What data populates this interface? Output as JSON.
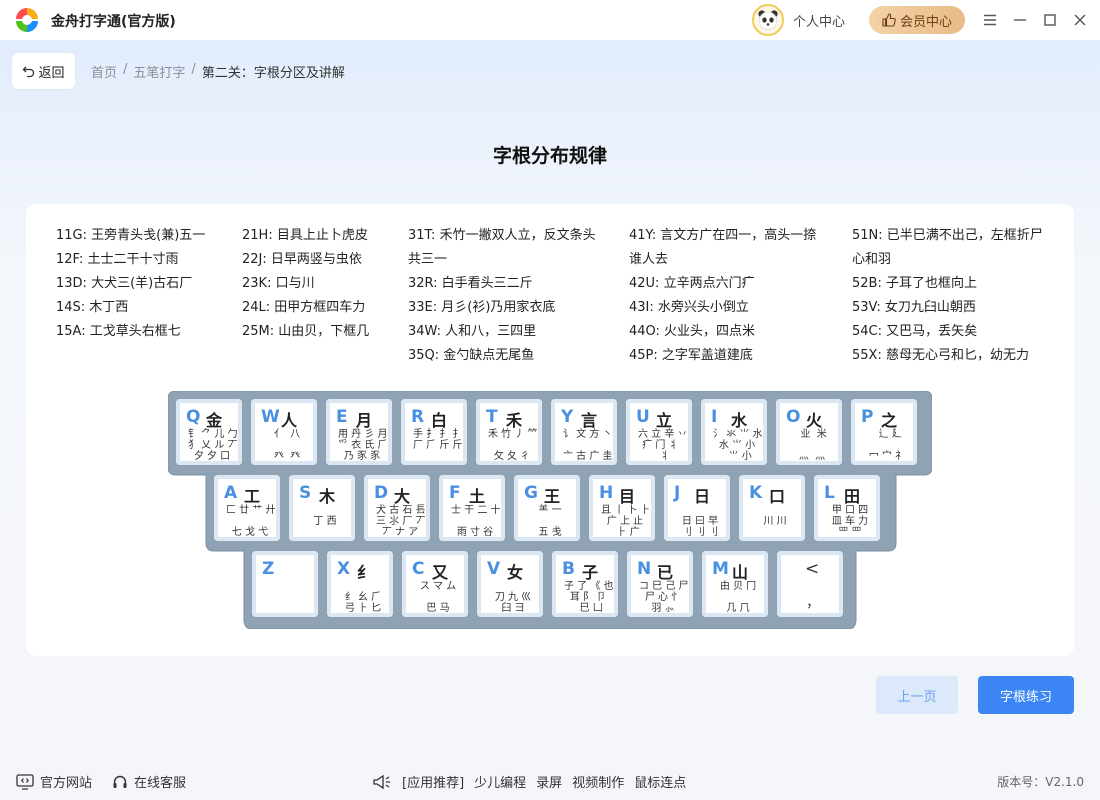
{
  "app": {
    "title": "金舟打字通(官方版)",
    "personal_center": "个人中心",
    "vip_center": "会员中心"
  },
  "nav": {
    "back_label": "返回",
    "breadcrumb": [
      "首页",
      "/",
      "五笔打字",
      "/",
      "第二关：字根分区及讲解"
    ]
  },
  "page": {
    "title": "字根分布规律"
  },
  "zones": {
    "col1": [
      "11G: 王旁青头戋(兼)五一",
      "12F: 土士二干十寸雨",
      "13D: 大犬三(羊)古石厂",
      "14S: 木丁西",
      "15A: 工戈草头右框七"
    ],
    "col2": [
      "21H: 目具上止卜虎皮",
      "22J: 日早两竖与虫依",
      "23K: 口与川",
      "24L: 田甲方框四车力",
      "25M: 山由贝，下框几"
    ],
    "col3": [
      "31T: 禾竹一撇双人立，反文条头共三一",
      "32R: 白手看头三二斤",
      "33E: 月彡(衫)乃用家衣底",
      "34W: 人和八，三四里",
      "35Q: 金勺缺点无尾鱼"
    ],
    "col4": [
      "41Y: 言文方广在四一，高头一捺谁人去",
      "42U: 立辛两点六门疒",
      "43I: 水旁兴头小倒立",
      "44O: 火业头，四点米",
      "45P: 之字军盖道建底"
    ],
    "col5": [
      "51N: 已半巳满不出己，左框折尸心和羽",
      "52B: 子耳了也框向上",
      "53V: 女刀九臼山朝西",
      "54C: 又巴马，丢矢矣",
      "55X: 慈母无心弓和匕，幼无力"
    ]
  },
  "keyboard": {
    "row1": [
      {
        "letter": "Q",
        "char": "金",
        "roots": "钅 ⺈ 儿 勹\n犭 乂 ル 丆\n夕 夕 口"
      },
      {
        "letter": "W",
        "char": "人",
        "roots": "亻  八\n  \n癶  癶"
      },
      {
        "letter": "E",
        "char": "月",
        "roots": "用 丹 彡 月\n爫 衣 氏 ⺁\n乃 豕 豕"
      },
      {
        "letter": "R",
        "char": "白",
        "roots": "手 扌 扌 ⺘\n厂 ⺁ 斤 斤"
      },
      {
        "letter": "T",
        "char": "禾",
        "roots": "禾 竹 丿 ⺮\n  \n攵 夂 彳"
      },
      {
        "letter": "Y",
        "char": "言",
        "roots": "讠 文 方 丶\n  \n亠 古 广 圭"
      },
      {
        "letter": "U",
        "char": "立",
        "roots": "六 立 辛 丷\n疒 门 丬 \n  丬"
      },
      {
        "letter": "I",
        "char": "水",
        "roots": "氵 氺 ⺌ 水\n水 ⺌ 小\n  ⺌ 小"
      },
      {
        "letter": "O",
        "char": "火",
        "roots": " 业  米\n \n灬  灬"
      },
      {
        "letter": "P",
        "char": "之",
        "roots": "  辶 廴\n  \n冖 宀 礻"
      }
    ],
    "row2": [
      {
        "letter": "A",
        "char": "工",
        "roots": "匚 廿 艹 廾\n  \n七 戈 弋"
      },
      {
        "letter": "S",
        "char": "木",
        "roots": "  \n丁 西"
      },
      {
        "letter": "D",
        "char": "大",
        "roots": "犬 古 石 镸\n三 ⺢ 厂 丆\n丆 ナ ア"
      },
      {
        "letter": "F",
        "char": "土",
        "roots": "士 干 二 十\n  \n雨 寸 ⾕"
      },
      {
        "letter": "G",
        "char": "王",
        "roots": "⺷ 一\n  \n五 戋"
      },
      {
        "letter": "H",
        "char": "目",
        "roots": "且 丨 卜 ⺊\n广 上 止\n  ⺊ 广"
      },
      {
        "letter": "J",
        "char": "日",
        "roots": "  \n日 曰 早\n刂 刂 刂"
      },
      {
        "letter": "K",
        "char": "口",
        "roots": "  \n川 川"
      },
      {
        "letter": "L",
        "char": "田",
        "roots": "甲 口 四\n皿 车 力\n罒 罒"
      }
    ],
    "row3": [
      {
        "letter": "Z",
        "char": "",
        "roots": ""
      },
      {
        "letter": "X",
        "char": "纟",
        "roots": "  \n纟 幺 ⺁\n弓 ⺊ 匕"
      },
      {
        "letter": "C",
        "char": "又",
        "roots": "ス マ ム\n  \n巴 马"
      },
      {
        "letter": "V",
        "char": "女",
        "roots": "  \n刀 九 巛\n臼 彐"
      },
      {
        "letter": "B",
        "char": "子",
        "roots": "子 了 《 也\n耳 阝 卩\n  巳 凵"
      },
      {
        "letter": "N",
        "char": "已",
        "roots": "コ 巳 己 尸\n尸 心 忄\n羽 ⺗"
      },
      {
        "letter": "M",
        "char": "山",
        "roots": "由 贝 冂\n  \n几 ⺇"
      },
      {
        "letter": "<",
        "char": "",
        "roots": "\n\n，"
      }
    ]
  },
  "buttons": {
    "prev": "上一页",
    "practice": "字根练习"
  },
  "footer": {
    "site": "官方网站",
    "service": "在线客服",
    "recommend": [
      "[应用推荐]",
      "少儿编程",
      "录屏",
      "视频制作",
      "鼠标连点"
    ],
    "version": "版本号：V2.1.0"
  }
}
